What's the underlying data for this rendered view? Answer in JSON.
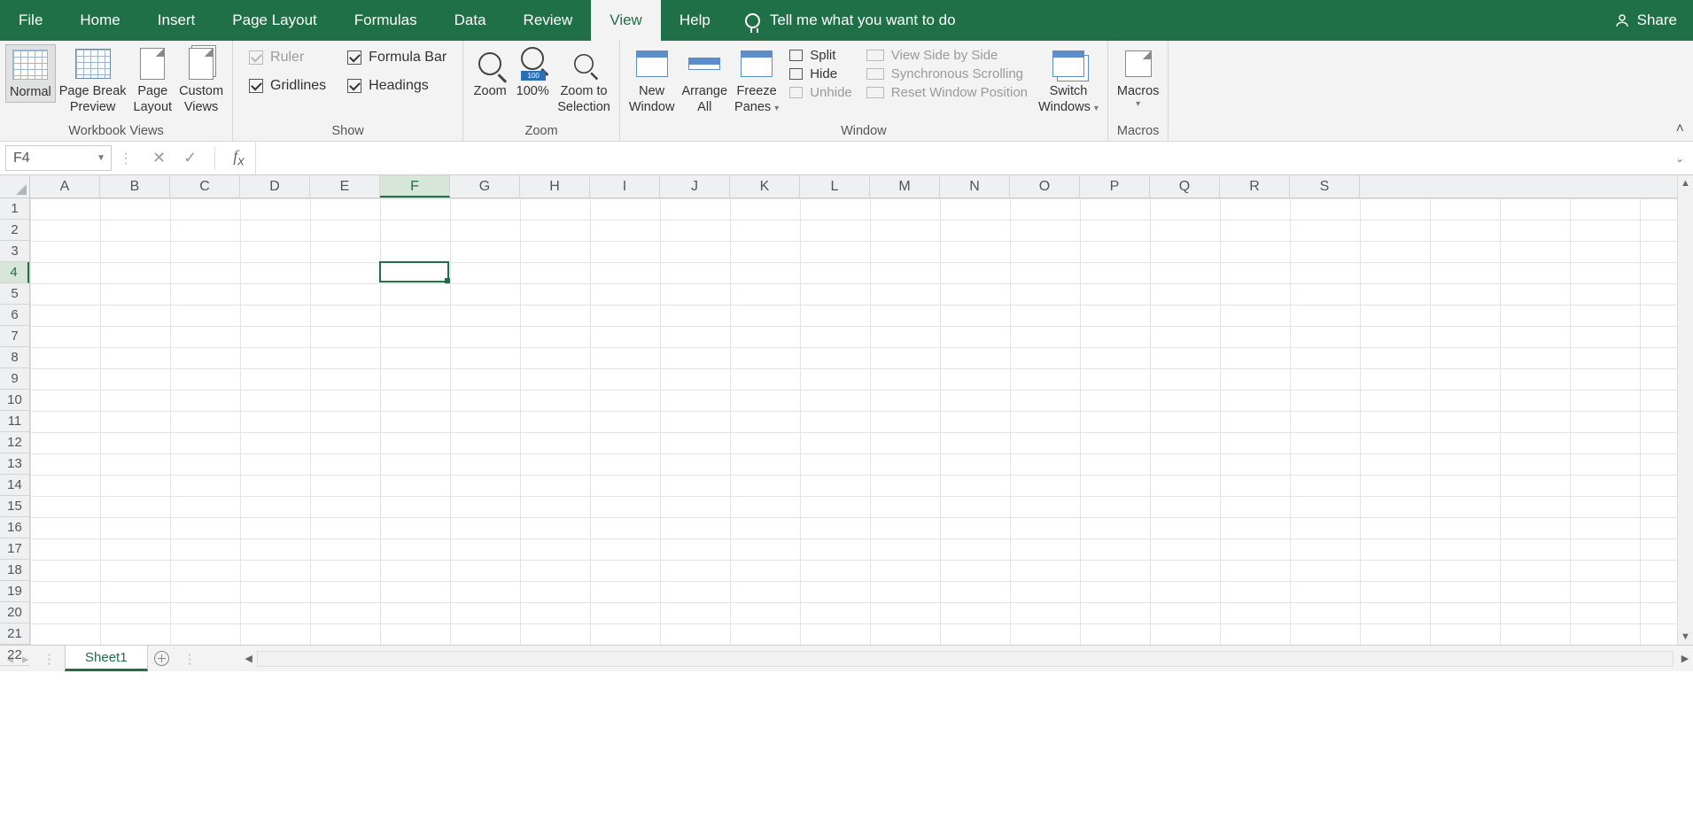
{
  "menu": {
    "tabs": [
      "File",
      "Home",
      "Insert",
      "Page Layout",
      "Formulas",
      "Data",
      "Review",
      "View",
      "Help"
    ],
    "active": "View",
    "tell_me": "Tell me what you want to do",
    "share": "Share"
  },
  "ribbon": {
    "workbook_views": {
      "label": "Workbook Views",
      "normal": "Normal",
      "page_break_l1": "Page Break",
      "page_break_l2": "Preview",
      "page_layout_l1": "Page",
      "page_layout_l2": "Layout",
      "custom_l1": "Custom",
      "custom_l2": "Views"
    },
    "show": {
      "label": "Show",
      "ruler": "Ruler",
      "formula_bar": "Formula Bar",
      "gridlines": "Gridlines",
      "headings": "Headings"
    },
    "zoom": {
      "label": "Zoom",
      "zoom": "Zoom",
      "pct": "100%",
      "pct_badge": "100",
      "sel_l1": "Zoom to",
      "sel_l2": "Selection"
    },
    "window": {
      "label": "Window",
      "new_l1": "New",
      "new_l2": "Window",
      "arr_l1": "Arrange",
      "arr_l2": "All",
      "frz_l1": "Freeze",
      "frz_l2": "Panes",
      "split": "Split",
      "hide": "Hide",
      "unhide": "Unhide",
      "sbs": "View Side by Side",
      "sync": "Synchronous Scrolling",
      "reset": "Reset Window Position",
      "switch_l1": "Switch",
      "switch_l2": "Windows"
    },
    "macros": {
      "label": "Macros",
      "btn": "Macros"
    }
  },
  "formula_bar": {
    "namebox": "F4",
    "formula": ""
  },
  "grid": {
    "columns": [
      "A",
      "B",
      "C",
      "D",
      "E",
      "F",
      "G",
      "H",
      "I",
      "J",
      "K",
      "L",
      "M",
      "N",
      "O",
      "P",
      "Q",
      "R",
      "S"
    ],
    "rows": [
      "1",
      "2",
      "3",
      "4",
      "5",
      "6",
      "7",
      "8",
      "9",
      "10",
      "11",
      "12",
      "13",
      "14",
      "15",
      "16",
      "17",
      "18",
      "19",
      "20",
      "21",
      "22"
    ],
    "selected_col_index": 5,
    "selected_row_index": 3
  },
  "sheet_tabs": {
    "active": "Sheet1"
  }
}
